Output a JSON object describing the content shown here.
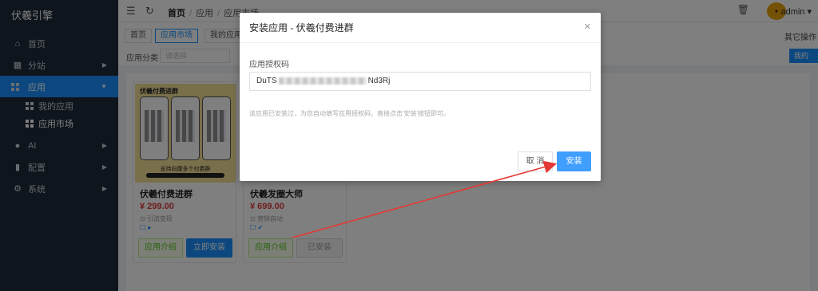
{
  "sidebar": {
    "brand": "伏羲引擎",
    "items": [
      {
        "label": "首页",
        "icon": "home-icon"
      },
      {
        "label": "分站",
        "icon": "building-icon"
      },
      {
        "label": "应用",
        "icon": "apps-icon"
      },
      {
        "label": "我的应用",
        "icon": "apps-icon"
      },
      {
        "label": "应用市场",
        "icon": "apps-icon"
      },
      {
        "label": "AI",
        "icon": "location-icon"
      },
      {
        "label": "配置",
        "icon": "bar-chart-icon"
      },
      {
        "label": "系统",
        "icon": "gear-icon"
      }
    ]
  },
  "topbar": {
    "breadcrumb": [
      "首页",
      "应用",
      "应用市场"
    ],
    "user": "admin"
  },
  "tabs": [
    "首页",
    "应用市场",
    "我的应用"
  ],
  "tab_ops": "其它操作",
  "filter": {
    "label": "应用分类",
    "placeholder": "请选择",
    "mine_button": "我的"
  },
  "cards": [
    {
      "name": "伏羲付费进群",
      "price": "¥ 299.00",
      "meta": "引流变现",
      "thumb_title": "伏羲付费进群",
      "thumb_caption": "支持向康多个付费群",
      "intro": "应用介绍",
      "action": "立即安装"
    },
    {
      "name": "伏羲发圈大师",
      "price": "¥ 699.00",
      "meta": "营销自动",
      "intro": "应用介绍",
      "action": "已安装"
    }
  ],
  "modal": {
    "title": "安装应用 - 伏羲付费进群",
    "field_label": "应用授权码",
    "code_prefix": "DuTS",
    "code_suffix": "Nd3Rj",
    "help": "该应用已安装过，为您自动填写应用授权码，直接点击'安装'按钮即可。",
    "cancel": "取 消",
    "confirm": "安装"
  },
  "colors": {
    "sidebar": "#1e2a3b",
    "accent": "#1890ff",
    "price": "#e03a3a",
    "annotation_arrow": "#e53935"
  }
}
